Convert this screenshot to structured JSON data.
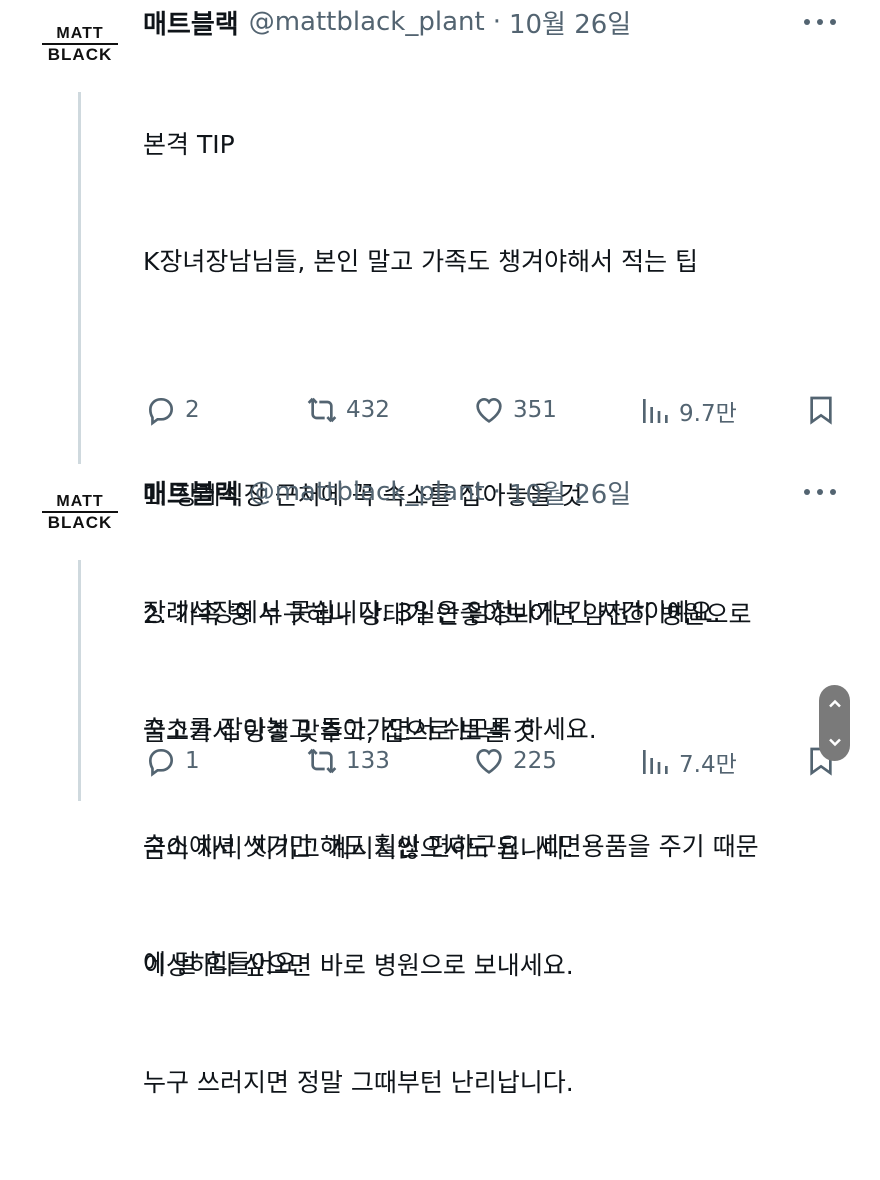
{
  "tweets": [
    {
      "avatar": {
        "line1": "MATT",
        "line2": "BLACK"
      },
      "name": "매트블랙",
      "handle": "@mattblack_plant",
      "separator": "·",
      "time": "10월 26일",
      "lines": [
        "본격 TIP",
        "K장녀장남님들, 본인 말고 가족도 챙겨야해서 적는 팁",
        "",
        "1. 장례식장 근처에 꼭 숙소를 잡아놓을 것",
        "장례식장에서 못쉽니다. 3일은 엄청나게 긴 시간이예요.",
        "숙소를 잡아놓고 돌아가면서 쉬도록 하세요.",
        "숙소에서 씻기만 해도 훨씬 편하구요. 세면용품을 주기 때문",
        "에 덜 힘들어요."
      ],
      "stats": {
        "replies": "2",
        "retweets": "432",
        "likes": "351",
        "views": "9.7만"
      }
    },
    {
      "avatar": {
        "line1": "MATT",
        "line2": "BLACK"
      },
      "name": "매트블랙",
      "handle": "@mattblack_plant",
      "separator": "·",
      "time": "10월 26일",
      "lines": [
        "2. 가족 중 누구하나 상태가 안좋아보이면 얌전히 병원으로",
        "끌고가서 링겔 맞추고, 집으로 보낼 것",
        "굳이 자리 지키고 계시지않으셔도 됩니다.",
        "이상하다 싶으면 바로 병원으로 보내세요.",
        "누구 쓰러지면 정말 그때부턴 난리납니다."
      ],
      "stats": {
        "replies": "1",
        "retweets": "133",
        "likes": "225",
        "views": "7.4만"
      }
    }
  ],
  "icons": {
    "reply": "reply-icon",
    "retweet": "retweet-icon",
    "like": "heart-icon",
    "views": "views-icon",
    "bookmark": "bookmark-icon",
    "more": "more-icon",
    "scroll_up": "chevron-up-icon",
    "scroll_down": "chevron-down-icon"
  },
  "colors": {
    "text": "#0f1419",
    "secondary": "#536471",
    "thread_line": "#cfd9de",
    "scroll_control": "#7a7a7a"
  }
}
